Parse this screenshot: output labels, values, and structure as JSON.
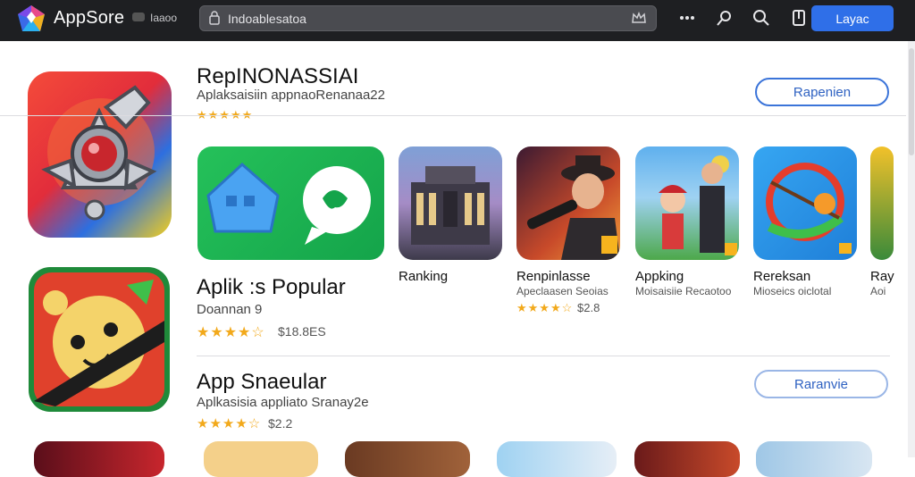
{
  "header": {
    "app_title": "AppSore",
    "sub_title": "Iaaoo",
    "search_value": "Indoablesatoa",
    "primary_button": "Layac"
  },
  "featured": {
    "title": "RepINONASSIAI",
    "subtitle": "Aplaksaisiin appnaoRenanaa22",
    "stars": "★★★★★",
    "button": "Rapenien"
  },
  "popular": {
    "title": "Aplik :s Popular",
    "subtitle": "Doannan 9",
    "stars": "★★★★☆",
    "price": "$18.8ES",
    "tiles": [
      {
        "title": "",
        "subtitle": ""
      },
      {
        "title": "Ranking",
        "subtitle": ""
      },
      {
        "title": "Renpinlasse",
        "subtitle": "Apeclaasen Seoias",
        "stars": "★★★★☆",
        "price": "$2.8"
      },
      {
        "title": "Appking",
        "subtitle": "Moisaisiie Recaotoo"
      },
      {
        "title": "Rereksan",
        "subtitle": "Mioseics oiclotal"
      },
      {
        "title": "Ray",
        "subtitle": "Aoi"
      }
    ]
  },
  "snapular": {
    "title": "App Snaeular",
    "subtitle": "Aplkasisia appliato Sranay2e",
    "stars": "★★★★☆",
    "price": "$2.2",
    "button": "Raranvie"
  },
  "colors": {
    "topbar": "#1e1f22",
    "accent": "#2f6fe8",
    "star": "#f2a91b"
  },
  "icons": [
    "logo-icon",
    "search-lead-icon",
    "crown-icon",
    "more-icon",
    "pin-icon",
    "search-icon",
    "bookmark-icon"
  ]
}
